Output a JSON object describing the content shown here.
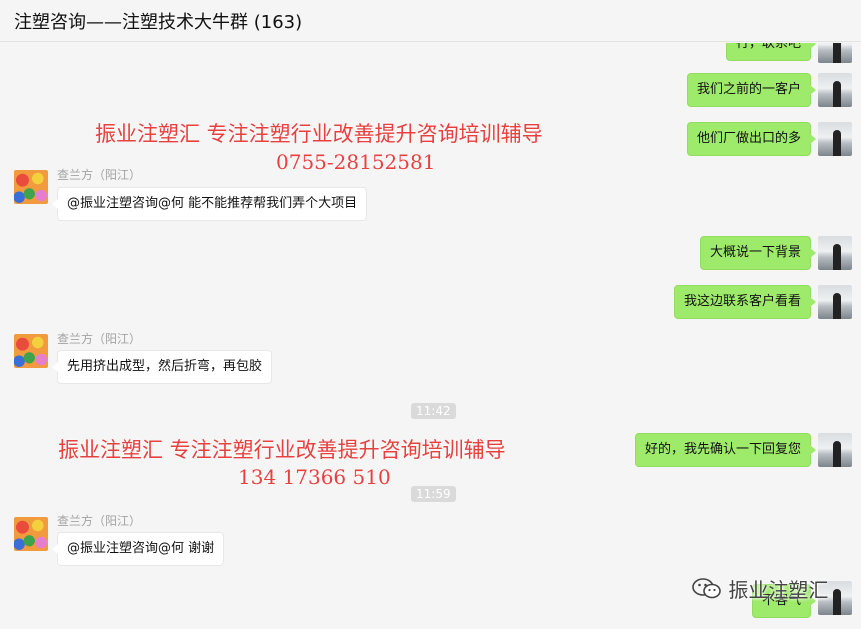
{
  "window": {
    "title": "注塑咨询——注塑技术大牛群 (163)"
  },
  "messages": [
    {
      "text": "行，联系吧"
    },
    {
      "text": "我们之前的一客户"
    },
    {
      "text": "他们厂做出口的多"
    },
    {
      "sender": "查兰方（阳江）",
      "text": "@振业注塑咨询@何 能不能推荐帮我们弄个大项目"
    },
    {
      "text": "大概说一下背景"
    },
    {
      "text": "我这边联系客户看看"
    },
    {
      "sender": "查兰方（阳江）",
      "text": "先用挤出成型，然后折弯，再包胶"
    },
    {
      "text": "好的，我先确认一下回复您"
    },
    {
      "sender": "查兰方（阳江）",
      "text": "@振业注塑咨询@何 谢谢"
    },
    {
      "text": "不客气"
    }
  ],
  "timestamps": [
    "11:42",
    "11:59"
  ],
  "overlays": {
    "line1": "振业注塑汇  专注注塑行业改善提升咨询培训辅导",
    "phone1": "0755-28152581",
    "line2": "振业注塑汇  专注注塑行业改善提升咨询培训辅导",
    "phone2": "134  17366  510"
  },
  "watermark": {
    "text": "振业注塑汇",
    "icon": "wechat-icon"
  },
  "colors": {
    "out_bubble": "#9eea6a",
    "overlay_text": "#e8403f"
  }
}
